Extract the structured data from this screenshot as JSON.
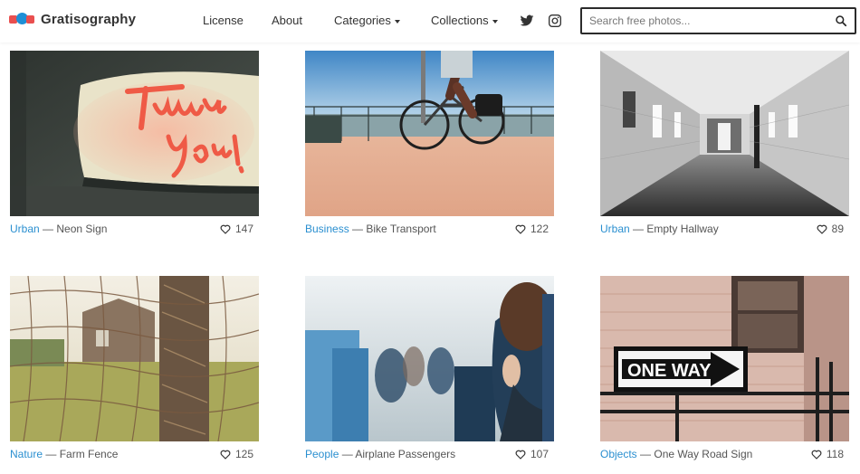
{
  "brand": {
    "name": "Gratisography"
  },
  "nav": {
    "license": "License",
    "about": "About",
    "categories": "Categories",
    "collections": "Collections"
  },
  "search": {
    "placeholder": "Search free photos...",
    "value": ""
  },
  "icons": {
    "twitter": "twitter-icon",
    "instagram": "instagram-icon",
    "search": "search-icon",
    "heart": "heart-icon"
  },
  "colors": {
    "accent": "#2a8fd0",
    "brand_red": "#e94f4f",
    "brand_blue": "#1e8fd6"
  },
  "photos": [
    {
      "category": "Urban",
      "sep": "—",
      "title": "Neon Sign",
      "likes": "147"
    },
    {
      "category": "Business",
      "sep": "—",
      "title": "Bike Transport",
      "likes": "122"
    },
    {
      "category": "Urban",
      "sep": "—",
      "title": "Empty Hallway",
      "likes": "89"
    },
    {
      "category": "Nature",
      "sep": "—",
      "title": "Farm Fence",
      "likes": "125"
    },
    {
      "category": "People",
      "sep": "—",
      "title": "Airplane Passengers",
      "likes": "107"
    },
    {
      "category": "Objects",
      "sep": "—",
      "title": "One Way Road Sign",
      "likes": "118"
    }
  ],
  "sign_text": {
    "neon": "Thank you!",
    "road": "ONE WAY"
  }
}
